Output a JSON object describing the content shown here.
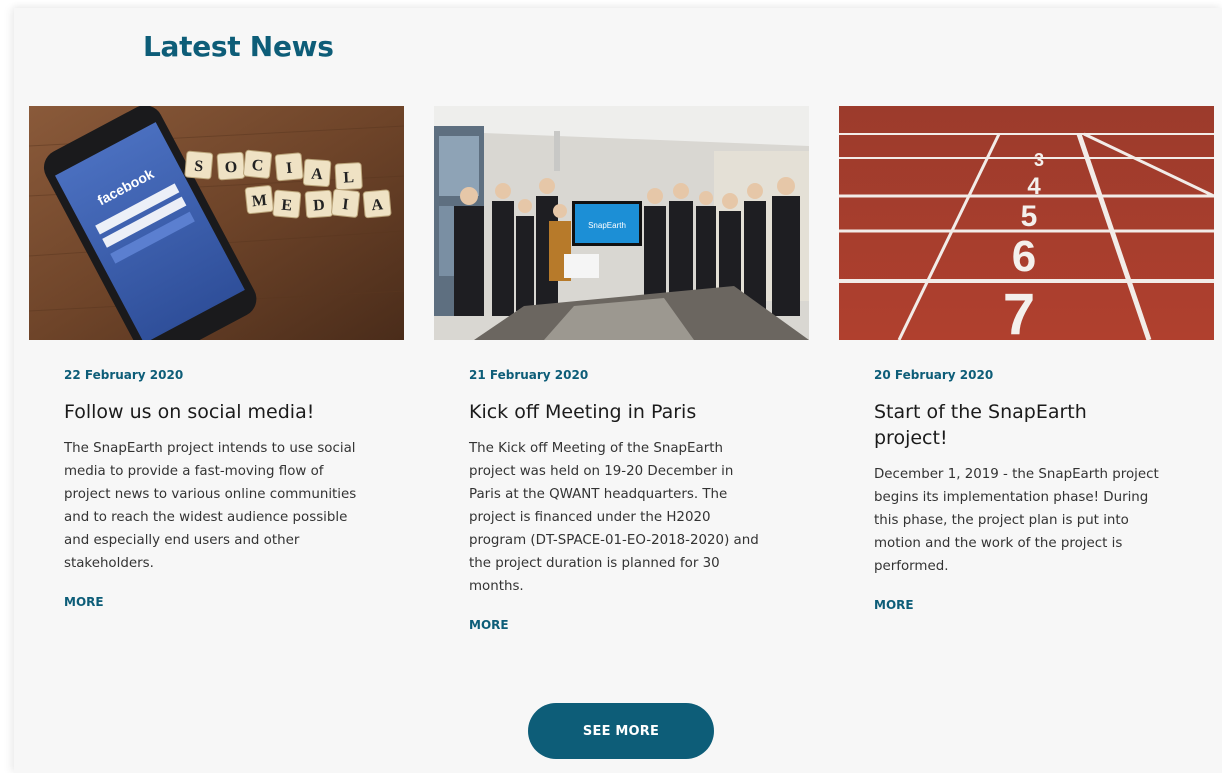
{
  "section": {
    "title": "Latest News"
  },
  "colors": {
    "accent": "#0d5d78",
    "panel_bg": "#f7f7f7",
    "text": "#333333"
  },
  "cards": [
    {
      "image": "social-media-phone-photo",
      "image_text": {
        "brand": "facebook",
        "tiles_row1": [
          "S",
          "O",
          "C",
          "I",
          "A",
          "L"
        ],
        "tiles_row2": [
          "M",
          "E",
          "D",
          "I",
          "A"
        ]
      },
      "date": "22 February 2020",
      "title": "Follow us on social media!",
      "text": "The SnapEarth project intends to use social media to provide a fast-moving flow of project news to various online communities and to reach the widest audience possible and especially end users and other stakeholders.",
      "more": "MORE"
    },
    {
      "image": "meeting-group-photo",
      "image_text": {
        "screen": "SnapEarth"
      },
      "date": "21 February 2020",
      "title": "Kick off Meeting in Paris",
      "text": "The Kick off Meeting of the SnapEarth project was held on 19-20 December in Paris at the QWANT headquarters. The project is financed under the H2020 program (DT-SPACE-01-EO-2018-2020) and the project duration is planned for 30 months.",
      "more": "MORE"
    },
    {
      "image": "running-track-photo",
      "image_text": {
        "lanes": [
          "3",
          "4",
          "5",
          "6",
          "7"
        ]
      },
      "date": "20 February 2020",
      "title": "Start of the SnapEarth project!",
      "text": "December 1, 2019 - the SnapEarth project begins its implementation phase! During this phase, the project plan is put into motion and the work of the project is performed.",
      "more": "MORE"
    }
  ],
  "see_more": "SEE MORE"
}
